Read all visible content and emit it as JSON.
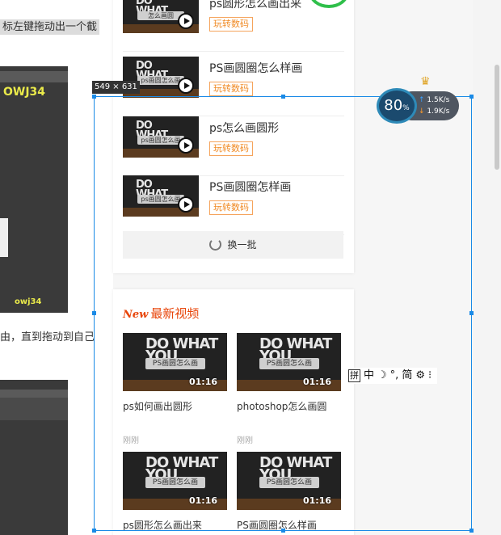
{
  "background_article": {
    "line1": "标左键拖动出一个截",
    "line2": "由，直到拖动到自己"
  },
  "screenshot_tool": {
    "size_label": "549 × 631",
    "accent_color": "#1a8ae6"
  },
  "net_monitor": {
    "percent": "80",
    "percent_unit": "%",
    "upload": "1.5K/s",
    "download": "1.9K/s"
  },
  "related_videos": {
    "items": [
      {
        "title": "ps圆形怎么画出来",
        "tag": "玩转数码",
        "thumb_text": "怎么画圆"
      },
      {
        "title": "PS画圆圈怎么样画",
        "tag": "玩转数码",
        "thumb_text": "ps画圆怎么画"
      },
      {
        "title": "ps怎么画圆形",
        "tag": "玩转数码",
        "thumb_text": "ps画圆怎么画"
      },
      {
        "title": "PS画圆圈怎样画",
        "tag": "玩转数码",
        "thumb_text": "ps画圆怎么画"
      }
    ],
    "refresh_label": "换一批"
  },
  "latest_videos": {
    "new_badge": "New",
    "title": "最新视频",
    "items": [
      {
        "title": "ps如何画出圆形",
        "duration": "01:16",
        "time": "刚刚",
        "thumb_text": "PS画圆怎么画"
      },
      {
        "title": "photoshop怎么画圆",
        "duration": "01:16",
        "time": "刚刚",
        "thumb_text": "PS画圆怎么画"
      },
      {
        "title": "ps圆形怎么画出来",
        "duration": "01:16",
        "time": "",
        "thumb_text": "PS画圆怎么画"
      },
      {
        "title": "PS画圆圈怎么样画",
        "duration": "01:16",
        "time": "",
        "thumb_text": "PS画圆怎么画"
      }
    ]
  },
  "ime_toolbar": {
    "pinyin": "拼",
    "lang": "中",
    "moon": "☽",
    "punct": "°,",
    "simplified": "简",
    "settings": "⚙",
    "more": "⁝"
  }
}
